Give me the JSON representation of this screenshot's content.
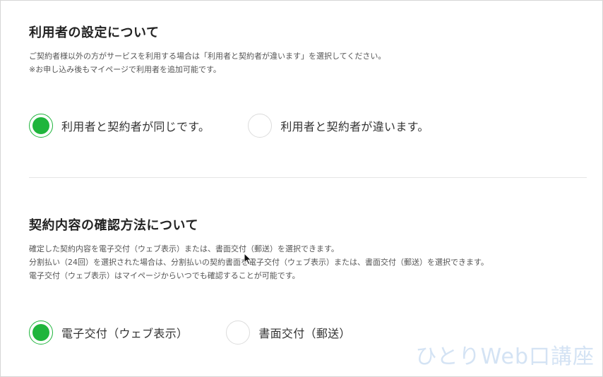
{
  "user_settings": {
    "title": "利用者の設定について",
    "desc_lines": [
      "ご契約者様以外の方がサービスを利用する場合は「利用者と契約者が違います」を選択してください。",
      "※お申し込み後もマイページで利用者を追加可能です。"
    ],
    "options": [
      {
        "label": "利用者と契約者が同じです。",
        "selected": true
      },
      {
        "label": "利用者と契約者が違います。",
        "selected": false
      }
    ]
  },
  "contract_confirmation": {
    "title": "契約内容の確認方法について",
    "desc_lines": [
      "確定した契約内容を電子交付（ウェブ表示）または、書面交付（郵送）を選択できます。",
      "分割払い（24回）を選択された場合は、分割払いの契約書面を電子交付（ウェブ表示）または、書面交付（郵送）を選択できます。",
      "電子交付（ウェブ表示）はマイページからいつでも確認することが可能です。"
    ],
    "options": [
      {
        "label": "電子交付（ウェブ表示）",
        "selected": true
      },
      {
        "label": "書面交付（郵送）",
        "selected": false
      }
    ]
  },
  "watermark": "ひとりWeb口講座",
  "colors": {
    "accent": "#1fb53c",
    "watermark": "#d4e3f4"
  },
  "icons": {
    "cursor": "mouse-pointer-icon"
  }
}
